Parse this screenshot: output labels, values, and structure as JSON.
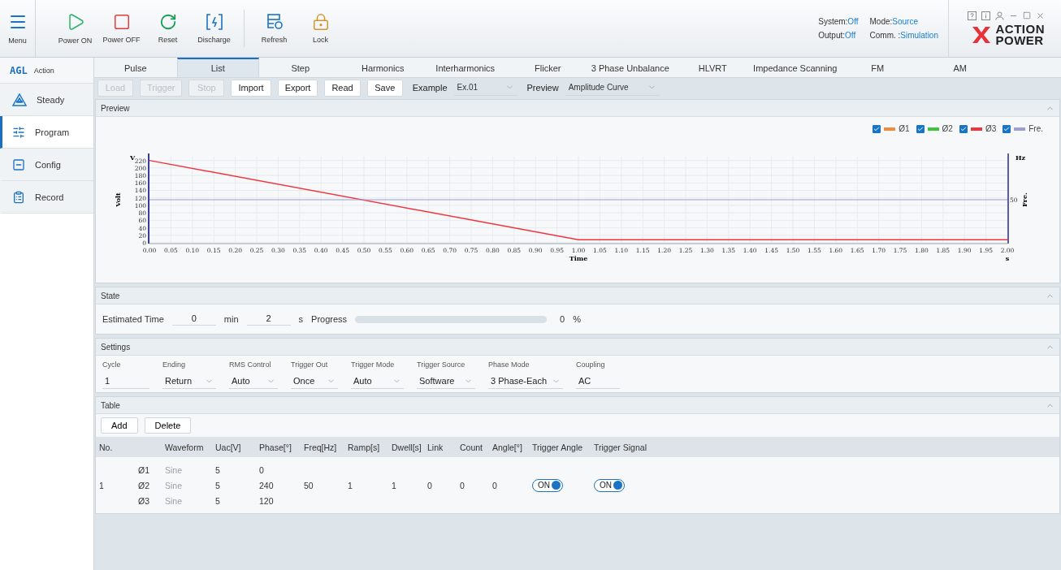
{
  "topbar": {
    "menu": "Menu",
    "actions": [
      {
        "label": "Power ON",
        "kind": "play",
        "separator_before": false
      },
      {
        "label": "Power OFF",
        "kind": "stop",
        "separator_before": false
      },
      {
        "label": "Reset",
        "kind": "reset",
        "separator_before": false
      },
      {
        "label": "Discharge",
        "kind": "discharge",
        "separator_before": false
      },
      {
        "label": "Refresh",
        "kind": "refresh",
        "separator_before": true
      },
      {
        "label": "Lock",
        "kind": "lock",
        "separator_before": false
      }
    ],
    "status": [
      {
        "label": "System:",
        "value": "Off"
      },
      {
        "label": "Mode:",
        "value": "Source"
      },
      {
        "label": "Output:",
        "value": "Off"
      },
      {
        "label": "Comm. :",
        "value": "Simulation"
      }
    ],
    "logo": {
      "line1": "ACTION",
      "line2": "POWER"
    }
  },
  "sidebar": {
    "brand": "AGL",
    "brand_label": "Action",
    "items": [
      {
        "label": "Steady",
        "kind": "steady",
        "selected": false
      },
      {
        "label": "Program",
        "kind": "program",
        "selected": true
      },
      {
        "label": "Config",
        "kind": "config",
        "selected": false
      },
      {
        "label": "Record",
        "kind": "record",
        "selected": false
      }
    ]
  },
  "tabs": [
    {
      "label": "Pulse",
      "selected": false
    },
    {
      "label": "List",
      "selected": true
    },
    {
      "label": "Step",
      "selected": false
    },
    {
      "label": "Harmonics",
      "selected": false
    },
    {
      "label": "Interharmonics",
      "selected": false
    },
    {
      "label": "Flicker",
      "selected": false
    },
    {
      "label": "3 Phase Unbalance",
      "selected": false
    },
    {
      "label": "HLVRT",
      "selected": false
    },
    {
      "label": "Impedance Scanning",
      "selected": false
    },
    {
      "label": "FM",
      "selected": false
    },
    {
      "label": "AM",
      "selected": false
    }
  ],
  "toolbar": {
    "buttons": [
      {
        "label": "Load",
        "disabled": true
      },
      {
        "label": "Trigger",
        "disabled": true
      },
      {
        "label": "Stop",
        "disabled": true
      },
      {
        "label": "Import",
        "disabled": false
      },
      {
        "label": "Export",
        "disabled": false
      },
      {
        "label": "Read",
        "disabled": false
      },
      {
        "label": "Save",
        "disabled": false
      }
    ],
    "selects": [
      {
        "label": "Example",
        "value": "Ex.01"
      },
      {
        "label": "Preview",
        "value": "Amplitude Curve"
      }
    ]
  },
  "preview": {
    "title": "Preview",
    "legend": [
      {
        "checked": true
      },
      {
        "checked": true
      },
      {
        "checked": true
      },
      {
        "checked": true
      }
    ],
    "frequency": {
      "legend_label": "Fre.",
      "axis_label": "Fre.",
      "color": "#9a9ed6",
      "unit": "Hz",
      "reading": "50"
    },
    "chart_data": {
      "type": "line",
      "xlabel": "Time",
      "ylabel": "Volt",
      "grid": true,
      "annotations": [
        {
          "text": "V"
        },
        {
          "text": "s"
        }
      ],
      "x": [
        0,
        1,
        2
      ],
      "series": [
        {
          "name": "Ø1",
          "color": "#f08a3c",
          "values": [
            null,
            null,
            null
          ]
        },
        {
          "name": "Ø2",
          "color": "#3cc43c",
          "values": [
            null,
            null,
            null
          ]
        },
        {
          "name": "Ø3",
          "color": "#f0343c",
          "values": [
            220,
            8,
            8
          ]
        }
      ],
      "xlim": [
        0,
        2
      ],
      "ylim": [
        0,
        230
      ],
      "xticks": [
        {
          "value": 0,
          "label": "0.00"
        },
        {
          "value": 0.05,
          "label": "0.05"
        },
        {
          "value": 0.1,
          "label": "0.10"
        },
        {
          "value": 0.15,
          "label": "0.15"
        },
        {
          "value": 0.2,
          "label": "0.20"
        },
        {
          "value": 0.25,
          "label": "0.25"
        },
        {
          "value": 0.3,
          "label": "0.30"
        },
        {
          "value": 0.35,
          "label": "0.35"
        },
        {
          "value": 0.4,
          "label": "0.40"
        },
        {
          "value": 0.45,
          "label": "0.45"
        },
        {
          "value": 0.5,
          "label": "0.50"
        },
        {
          "value": 0.55,
          "label": "0.55"
        },
        {
          "value": 0.6,
          "label": "0.60"
        },
        {
          "value": 0.65,
          "label": "0.65"
        },
        {
          "value": 0.7,
          "label": "0.70"
        },
        {
          "value": 0.75,
          "label": "0.75"
        },
        {
          "value": 0.8,
          "label": "0.80"
        },
        {
          "value": 0.85,
          "label": "0.85"
        },
        {
          "value": 0.9,
          "label": "0.90"
        },
        {
          "value": 0.95,
          "label": "0.95"
        },
        {
          "value": 1,
          "label": "1.00"
        },
        {
          "value": 1.05,
          "label": "1.05"
        },
        {
          "value": 1.1,
          "label": "1.10"
        },
        {
          "value": 1.15,
          "label": "1.15"
        },
        {
          "value": 1.2,
          "label": "1.20"
        },
        {
          "value": 1.25,
          "label": "1.25"
        },
        {
          "value": 1.3,
          "label": "1.30"
        },
        {
          "value": 1.35,
          "label": "1.35"
        },
        {
          "value": 1.4,
          "label": "1.40"
        },
        {
          "value": 1.45,
          "label": "1.45"
        },
        {
          "value": 1.5,
          "label": "1.50"
        },
        {
          "value": 1.55,
          "label": "1.55"
        },
        {
          "value": 1.6,
          "label": "1.60"
        },
        {
          "value": 1.65,
          "label": "1.65"
        },
        {
          "value": 1.7,
          "label": "1.70"
        },
        {
          "value": 1.75,
          "label": "1.75"
        },
        {
          "value": 1.8,
          "label": "1.80"
        },
        {
          "value": 1.85,
          "label": "1.85"
        },
        {
          "value": 1.9,
          "label": "1.90"
        },
        {
          "value": 1.95,
          "label": "1.95"
        },
        {
          "value": 2,
          "label": "2.00"
        }
      ],
      "yticks": [
        0,
        20,
        40,
        60,
        80,
        100,
        120,
        140,
        160,
        180,
        200,
        220
      ]
    }
  },
  "state": {
    "title": "State",
    "estimated_label": "Estimated Time",
    "minutes": "0",
    "min_unit": "min",
    "seconds": "2",
    "s_unit": "s",
    "progress_label": "Progress",
    "level": 0,
    "progress_value": "0",
    "progress_unit": "%"
  },
  "settings": {
    "title": "Settings",
    "fields": [
      {
        "label": "Cycle",
        "value": "1",
        "kind": "text"
      },
      {
        "label": "Ending",
        "value": "Return",
        "kind": "select"
      },
      {
        "label": "RMS Control",
        "value": "Auto",
        "kind": "select"
      },
      {
        "label": "Trigger Out",
        "value": "Once",
        "kind": "select"
      },
      {
        "label": "Trigger Mode",
        "value": "Auto",
        "kind": "select"
      },
      {
        "label": "Trigger Source",
        "value": "Software",
        "kind": "select"
      },
      {
        "label": "Phase Mode",
        "value": "3 Phase-Each",
        "kind": "select"
      },
      {
        "label": "Coupling",
        "value": "AC",
        "kind": "text"
      }
    ]
  },
  "table": {
    "title": "Table",
    "buttons": [
      "Add",
      "Delete"
    ],
    "columns": [
      "No.",
      "Waveform",
      "Uac[V]",
      "Phase[°]",
      "Freq[Hz]",
      "Ramp[s]",
      "Dwell[s]",
      "Link",
      "Count",
      "Angle[°]",
      "Trigger Angle",
      "Trigger Signal"
    ],
    "rows": [
      {
        "no": "1",
        "phases": [
          {
            "phase": "Ø1",
            "waveform": "Sine",
            "uac": "5",
            "phase_deg": "0"
          },
          {
            "phase": "Ø2",
            "waveform": "Sine",
            "uac": "5",
            "phase_deg": "240"
          },
          {
            "phase": "Ø3",
            "waveform": "Sine",
            "uac": "5",
            "phase_deg": "120"
          }
        ],
        "freq": "50",
        "ramp": "1",
        "dwell": "1",
        "link": "0",
        "count": "0",
        "angle": "0",
        "trigger_angle": {
          "label": "ON",
          "on": true
        },
        "trigger_signal": {
          "label": "ON",
          "on": true
        }
      }
    ]
  }
}
